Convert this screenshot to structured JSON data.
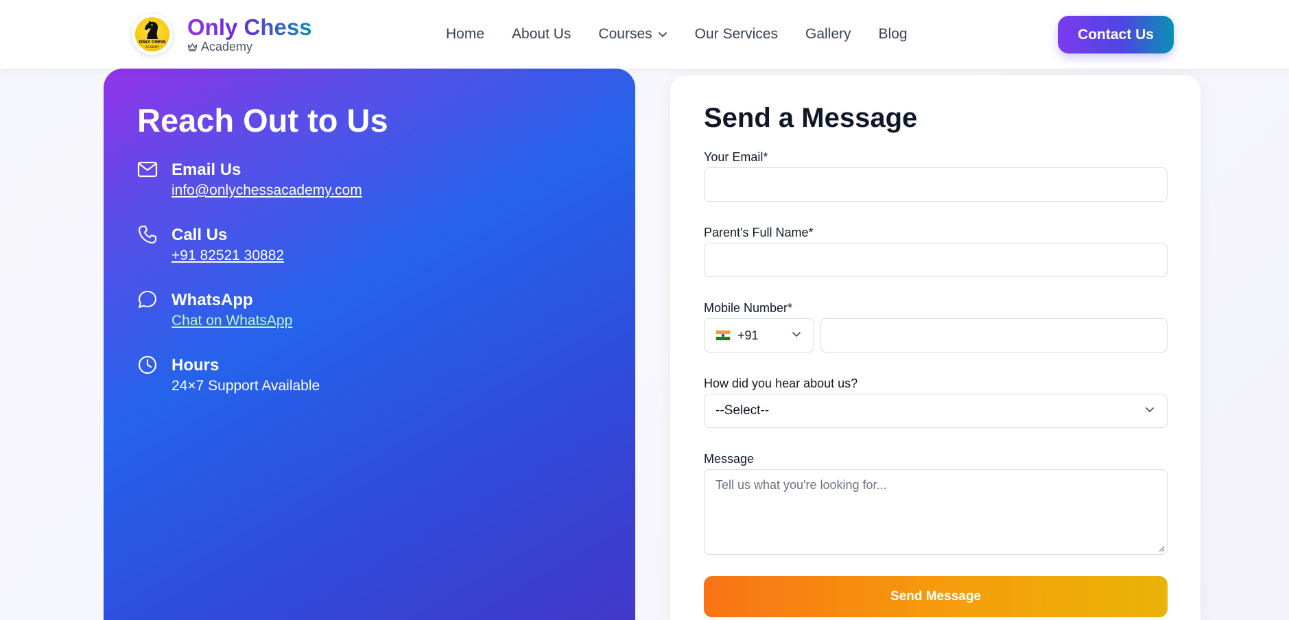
{
  "header": {
    "brand_title": "Only Chess",
    "brand_subtitle": "Academy",
    "logo_word": "ONLY CHESS",
    "logo_subword": "ACADEMY",
    "nav": [
      {
        "label": "Home"
      },
      {
        "label": "About Us"
      },
      {
        "label": "Courses"
      },
      {
        "label": "Our Services"
      },
      {
        "label": "Gallery"
      },
      {
        "label": "Blog"
      }
    ],
    "contact_button": "Contact Us"
  },
  "reach": {
    "title": "Reach Out to Us",
    "items": [
      {
        "title": "Email Us",
        "value": "info@onlychessacademy.com",
        "icon": "mail-icon"
      },
      {
        "title": "Call Us",
        "value": "+91 82521 30882",
        "icon": "phone-icon"
      },
      {
        "title": "WhatsApp",
        "value": "Chat on WhatsApp",
        "icon": "chat-bubble-icon"
      },
      {
        "title": "Hours",
        "value": "24×7 Support Available",
        "icon": "clock-icon"
      }
    ]
  },
  "form": {
    "title": "Send a Message",
    "email_label": "Your Email*",
    "email_value": "",
    "parent_label": "Parent's Full Name*",
    "parent_value": "",
    "mobile_label": "Mobile Number*",
    "country_code": "+91",
    "mobile_value": "",
    "source_label": "How did you hear about us?",
    "source_selected": "--Select--",
    "message_label": "Message",
    "message_placeholder": "Tell us what you're looking for...",
    "submit_label": "Send Message"
  },
  "colors": {
    "brand_purple": "#7c3aed",
    "brand_blue": "#2563eb",
    "brand_teal": "#0891b2",
    "submit_orange": "#f97316",
    "submit_yellow": "#eab308"
  }
}
